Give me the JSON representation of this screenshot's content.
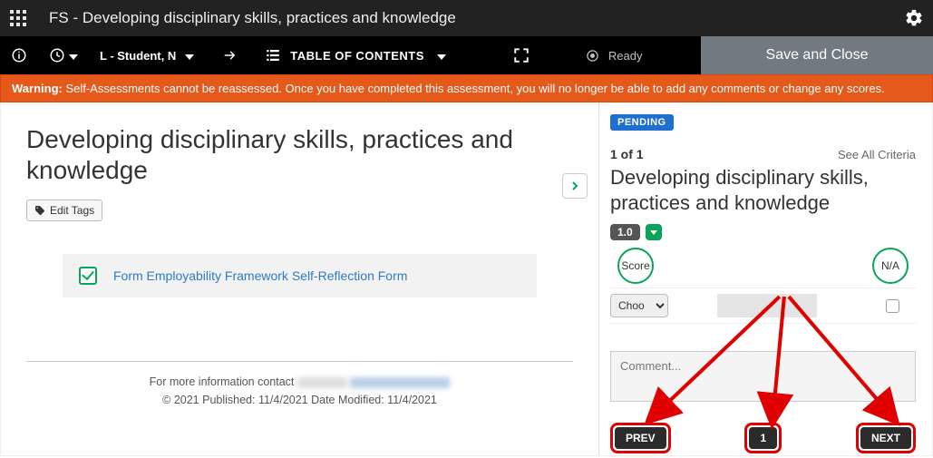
{
  "header": {
    "app_prefix": "FS - ",
    "title": "Developing disciplinary skills, practices and knowledge"
  },
  "toolbar": {
    "user_label": "L - Student, N",
    "toc_label": "TABLE OF CONTENTS",
    "ready_label": "Ready",
    "save_label": "Save and Close"
  },
  "warning": {
    "prefix": "Warning:",
    "text": " Self-Assessments cannot be reassessed. Once you have completed this assessment, you will no longer be able to add any comments or change any scores."
  },
  "left": {
    "heading": "Developing disciplinary skills, practices and knowledge",
    "edit_tags_label": "Edit Tags",
    "form_link": "Form Employability Framework Self-Reflection Form",
    "footer_contact": "For more information contact ",
    "footer_meta": "© 2021             Published: 11/4/2021 Date Modified: 11/4/2021"
  },
  "right": {
    "status_badge": "PENDING",
    "count_label": "1 of 1",
    "see_all_label": "See All Criteria",
    "criteria_title": "Developing disciplinary skills, practices and knowledge",
    "score_pill": "1.0",
    "score_label": "Score",
    "na_label": "N/A",
    "dropdown_value": "Choo",
    "comment_placeholder": "Comment...",
    "prev_label": "PREV",
    "page_label": "1",
    "next_label": "NEXT"
  }
}
